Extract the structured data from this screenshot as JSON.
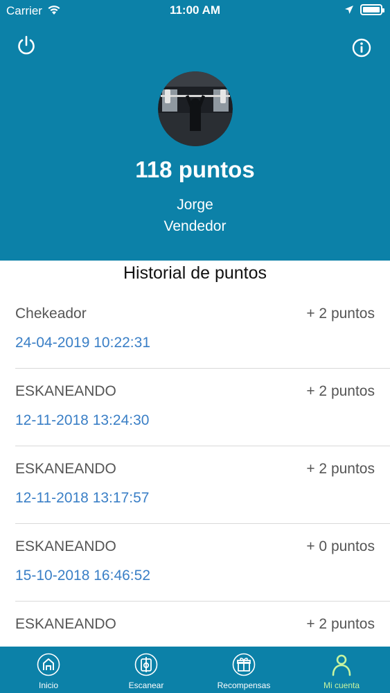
{
  "status_bar": {
    "carrier": "Carrier",
    "time": "11:00 AM"
  },
  "header": {
    "points": "118 puntos",
    "name": "Jorge",
    "role": "Vendedor"
  },
  "history": {
    "title": "Historial de puntos",
    "items": [
      {
        "label": "Chekeador",
        "points": "+ 2 puntos",
        "date": "24-04-2019 10:22:31"
      },
      {
        "label": "ESKANEANDO",
        "points": "+ 2 puntos",
        "date": "12-11-2018 13:24:30"
      },
      {
        "label": "ESKANEANDO",
        "points": "+ 2 puntos",
        "date": "12-11-2018 13:17:57"
      },
      {
        "label": "ESKANEANDO",
        "points": "+ 0 puntos",
        "date": "15-10-2018 16:46:52"
      },
      {
        "label": "ESKANEANDO",
        "points": "+ 2 puntos",
        "date": ""
      }
    ]
  },
  "tabs": [
    {
      "label": "Inicio",
      "icon": "home-icon"
    },
    {
      "label": "Escanear",
      "icon": "scan-icon"
    },
    {
      "label": "Recompensas",
      "icon": "gift-icon"
    },
    {
      "label": "Mi cuenta",
      "icon": "user-icon",
      "active": true
    }
  ],
  "colors": {
    "primary": "#0c81a8",
    "active_tab": "#c8f5a0",
    "date_text": "#3a7fc6"
  }
}
